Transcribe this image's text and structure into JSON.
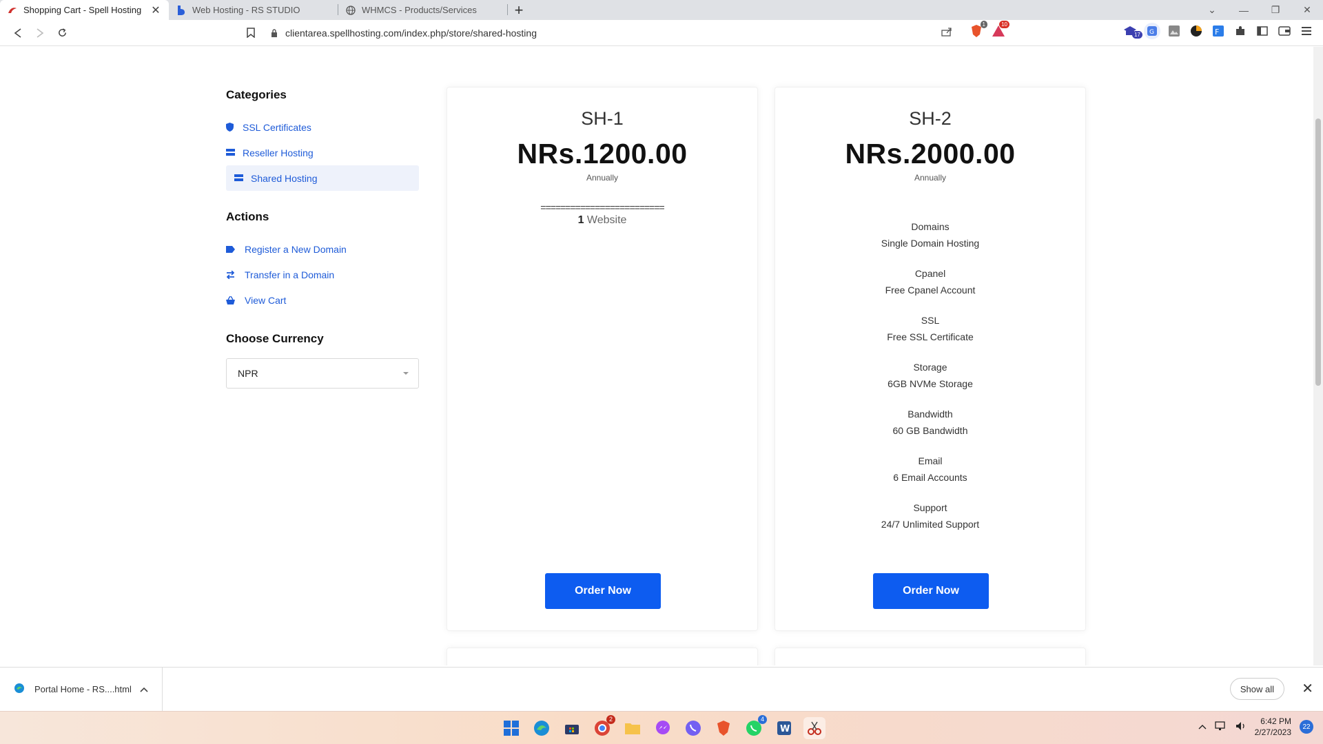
{
  "browser": {
    "tabs": [
      {
        "title": "Shopping Cart - Spell Hosting",
        "active": true
      },
      {
        "title": "Web Hosting - RS STUDIO",
        "active": false
      },
      {
        "title": "WHMCS - Products/Services",
        "active": false
      }
    ],
    "close_glyph": "✕",
    "new_tab_glyph": "+",
    "url": "clientarea.spellhosting.com/index.php/store/shared-hosting",
    "ext_badge_1": "17",
    "brave_badge": "1",
    "alert_badge": "10"
  },
  "sidebar": {
    "categories_heading": "Categories",
    "categories": [
      {
        "label": "SSL Certificates",
        "icon": "shield-icon"
      },
      {
        "label": "Reseller Hosting",
        "icon": "server-icon"
      },
      {
        "label": "Shared Hosting",
        "icon": "server-icon",
        "active": true
      }
    ],
    "actions_heading": "Actions",
    "actions": [
      {
        "label": "Register a New Domain",
        "icon": "tag-icon"
      },
      {
        "label": "Transfer in a Domain",
        "icon": "exchange-icon"
      },
      {
        "label": "View Cart",
        "icon": "basket-icon"
      }
    ],
    "currency_heading": "Choose Currency",
    "currency_value": "NPR"
  },
  "products": [
    {
      "name": "SH-1",
      "price": "NRs.1200.00",
      "cycle": "Annually",
      "separator": "=========================",
      "feature_count": "1",
      "feature_unit": "Website",
      "button": "Order Now"
    },
    {
      "name": "SH-2",
      "price": "NRs.2000.00",
      "cycle": "Annually",
      "features": [
        {
          "title": "Domains",
          "value": "Single Domain Hosting"
        },
        {
          "title": "Cpanel",
          "value": "Free Cpanel Account"
        },
        {
          "title": "SSL",
          "value": "Free SSL Certificate"
        },
        {
          "title": "Storage",
          "value": "6GB NVMe Storage"
        },
        {
          "title": "Bandwidth",
          "value": "60 GB Bandwidth"
        },
        {
          "title": "Email",
          "value": "6 Email Accounts"
        },
        {
          "title": "Support",
          "value": "24/7 Unlimited Support"
        }
      ],
      "button": "Order Now"
    }
  ],
  "downloads": {
    "file": "Portal Home - RS....html",
    "show_all": "Show all",
    "close_glyph": "✕"
  },
  "taskbar": {
    "time": "6:42 PM",
    "date": "2/27/2023",
    "notification_count": "22",
    "badge_1": "2",
    "badge_2": "4"
  },
  "colors": {
    "accent": "#0d5cf0",
    "link": "#1e5bd8",
    "active_bg": "#eef2fb"
  }
}
